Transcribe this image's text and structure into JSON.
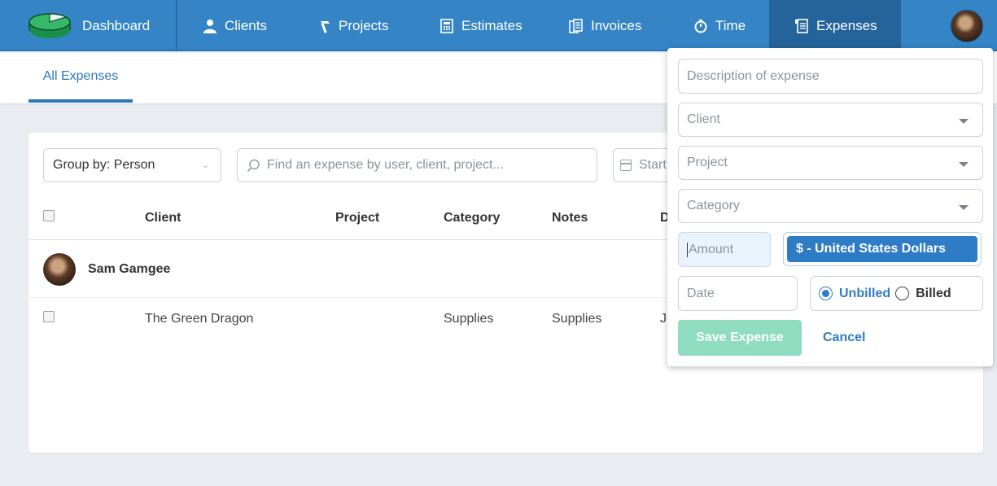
{
  "nav": {
    "items": [
      {
        "label": "Dashboard",
        "icon": "logo-icon"
      },
      {
        "label": "Clients",
        "icon": "person-icon"
      },
      {
        "label": "Projects",
        "icon": "hammer-icon"
      },
      {
        "label": "Estimates",
        "icon": "calculator-icon"
      },
      {
        "label": "Invoices",
        "icon": "documents-icon"
      },
      {
        "label": "Time",
        "icon": "stopwatch-icon"
      },
      {
        "label": "Expenses",
        "icon": "receipt-icon"
      }
    ],
    "active": "Expenses"
  },
  "subheader": {
    "tab_label": "All Expenses"
  },
  "filters": {
    "group_by": "Group by: Person",
    "search_placeholder": "Find an expense by user, client, project...",
    "start_date": "Start"
  },
  "table": {
    "headers": [
      "Client",
      "Project",
      "Category",
      "Notes",
      "D"
    ],
    "groups": [
      {
        "person": "Sam Gamgee",
        "rows": [
          {
            "client": "The Green Dragon",
            "project": "",
            "category": "Supplies",
            "notes": "Supplies",
            "date": "J"
          }
        ]
      }
    ]
  },
  "popover": {
    "description_placeholder": "Description of expense",
    "client_placeholder": "Client",
    "project_placeholder": "Project",
    "category_placeholder": "Category",
    "amount_placeholder": "Amount",
    "currency": "$ - United States Dollars",
    "date_placeholder": "Date",
    "billing_options": [
      "Unbilled",
      "Billed"
    ],
    "billing_selected": "Unbilled",
    "save_label": "Save Expense",
    "cancel_label": "Cancel"
  },
  "colors": {
    "nav": "#3585c6",
    "nav_active": "#24649a",
    "accent": "#2f7cc6",
    "save_button": "#8fdcc0"
  }
}
